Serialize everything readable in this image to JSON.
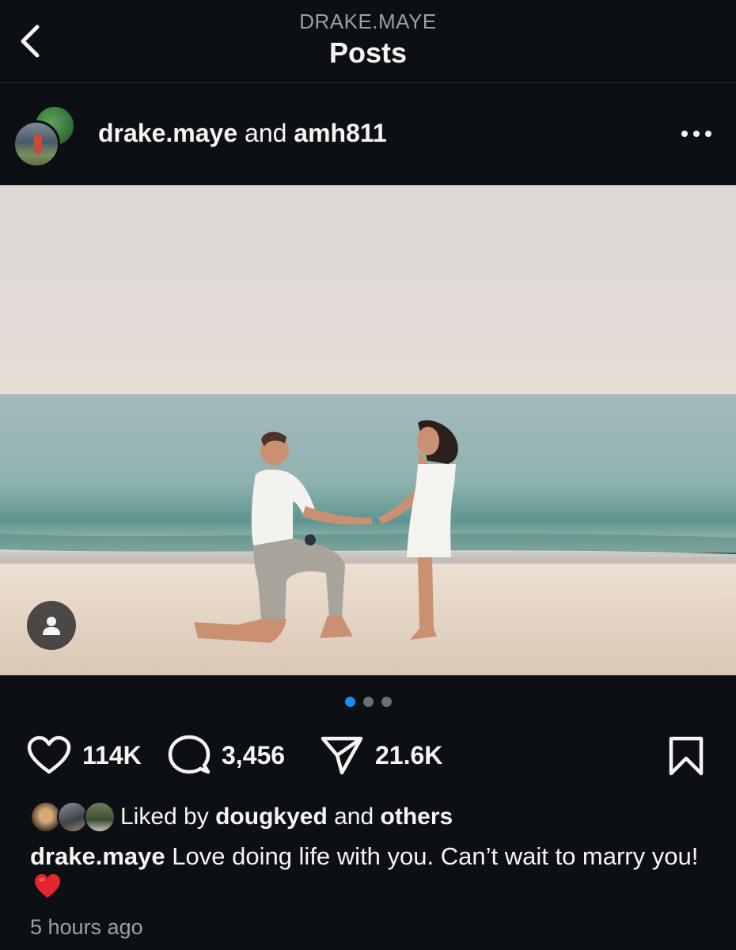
{
  "header": {
    "subtitle": "DRAKE.MAYE",
    "title": "Posts"
  },
  "post": {
    "author": "drake.maye",
    "connector": "and",
    "collaborator": "amh811",
    "carousel": {
      "total": 3,
      "active_index": 0
    },
    "actions": {
      "likes": "114K",
      "comments": "3,456",
      "shares": "21.6K"
    },
    "liked_by": {
      "prefix": "Liked by",
      "user": "dougkyed",
      "connector": "and",
      "others": "others"
    },
    "caption": {
      "username": "drake.maye",
      "text": "Love doing life with you. Can’t wait to marry you!"
    },
    "timestamp": "5 hours ago"
  },
  "icons": {
    "back": "chevron-left-icon",
    "more": "more-horizontal-icon",
    "tag": "person-tag-icon",
    "like": "heart-icon",
    "comment": "comment-icon",
    "share": "send-icon",
    "save": "bookmark-icon"
  },
  "colors": {
    "background": "#0c0f14",
    "active_dot": "#1a8cf0",
    "secondary_text": "#9ba0a8"
  }
}
